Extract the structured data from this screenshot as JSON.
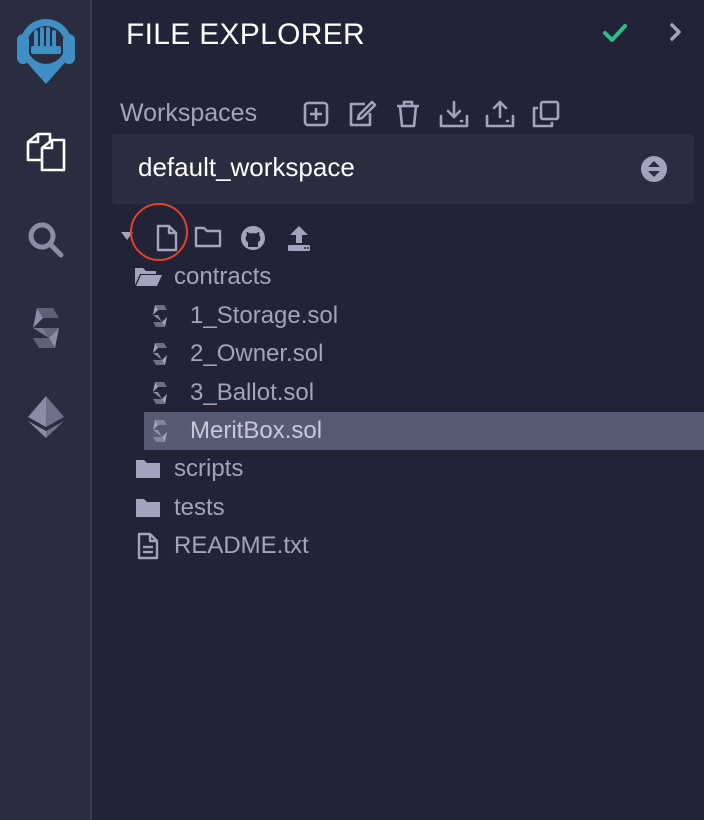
{
  "icon_panel": {
    "items": [
      {
        "name": "remix-logo-icon"
      },
      {
        "name": "file-explorer-icon"
      },
      {
        "name": "search-icon"
      },
      {
        "name": "solidity-compiler-icon"
      },
      {
        "name": "deploy-run-icon"
      }
    ]
  },
  "header": {
    "title": "FILE EXPLORER",
    "status_icon": "check-icon",
    "collapse_icon": "chevron-right-icon"
  },
  "workspaces": {
    "label": "Workspaces",
    "actions": [
      "create-workspace-icon",
      "rename-workspace-icon",
      "delete-workspace-icon",
      "download-workspace-icon",
      "restore-workspace-icon",
      "clone-workspace-icon"
    ],
    "selected": "default_workspace"
  },
  "file_toolbar": {
    "actions": [
      "new-file-icon",
      "new-folder-icon",
      "github-gist-icon",
      "upload-file-icon"
    ]
  },
  "tree": {
    "items": [
      {
        "label": "contracts",
        "type": "folder-open"
      },
      {
        "label": "1_Storage.sol",
        "type": "solidity"
      },
      {
        "label": "2_Owner.sol",
        "type": "solidity"
      },
      {
        "label": "3_Ballot.sol",
        "type": "solidity"
      },
      {
        "label": "MeritBox.sol",
        "type": "solidity",
        "selected": true
      },
      {
        "label": "scripts",
        "type": "folder"
      },
      {
        "label": "tests",
        "type": "folder"
      },
      {
        "label": "README.txt",
        "type": "file"
      }
    ]
  },
  "colors": {
    "background": "#222336",
    "panel": "#2a2c3f",
    "selected_row": "#565a72",
    "check": "#2fbc85",
    "highlight": "#e4412c",
    "logo": "#3f8fc4"
  }
}
